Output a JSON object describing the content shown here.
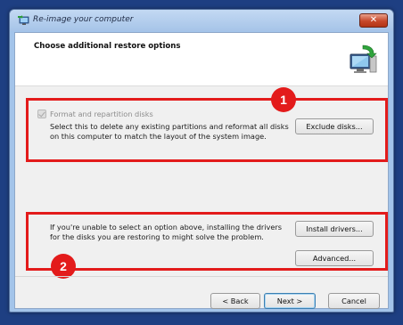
{
  "window": {
    "title": "Re-image your computer",
    "close_glyph": "✕"
  },
  "header": {
    "heading": "Choose additional restore options",
    "icon": "computer-restore-icon"
  },
  "format_section": {
    "checkbox_label": "Format and repartition disks",
    "checkbox_checked": true,
    "checkbox_enabled": false,
    "description_line1": "Select this to delete any existing partitions and reformat all disks",
    "description_line2": "on this computer to match the layout of the system image.",
    "exclude_button": "Exclude disks..."
  },
  "drivers_section": {
    "description_line1": "If you're unable to select an option above, installing the drivers",
    "description_line2": "for the disks you are restoring to might solve the problem.",
    "install_button": "Install drivers...",
    "advanced_button": "Advanced..."
  },
  "annotations": {
    "badge1": "1",
    "badge2": "2",
    "highlight_color": "#e31b1b"
  },
  "footer": {
    "back_button": "< Back",
    "next_button": "Next >",
    "cancel_button": "Cancel"
  }
}
